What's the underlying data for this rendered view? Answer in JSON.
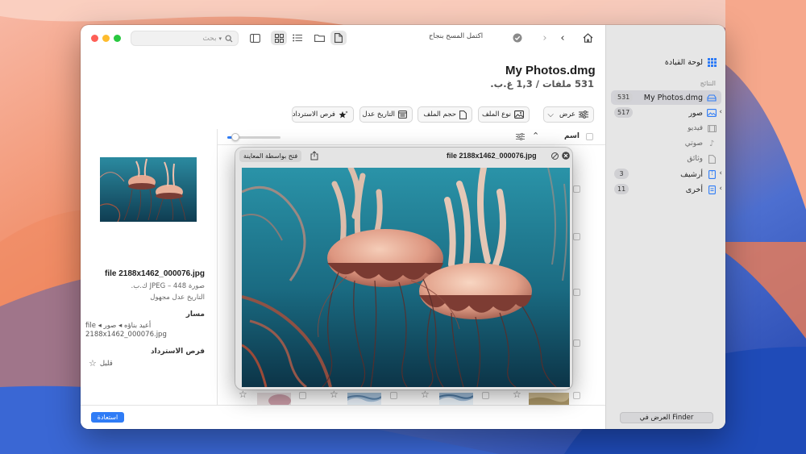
{
  "toolbar": {
    "search_placeholder": "بحث",
    "status_text": "اكتمل المسح بنجاح"
  },
  "header": {
    "title": "My Photos.dmg",
    "subtitle": "531 ملفات / 1,3 غ.ب."
  },
  "filters": {
    "view": "عرض",
    "file_type": "نوع الملف",
    "file_size": "حجم الملف",
    "date_modified": "التاريخ عدل",
    "recovery_chances": "فرص الاسترداد"
  },
  "list": {
    "column_name": "اسم",
    "zoom_level": 0.15
  },
  "sidebar": {
    "dashboard": "لوحة القيادة",
    "results_section": "النتائج",
    "items": [
      {
        "label": "My Photos.dmg",
        "count": "531"
      },
      {
        "label": "صور",
        "count": "517"
      },
      {
        "label": "فيديو",
        "count": ""
      },
      {
        "label": "صوتي",
        "count": ""
      },
      {
        "label": "وثائق",
        "count": ""
      },
      {
        "label": "أرشيف",
        "count": "3"
      },
      {
        "label": "أخرى",
        "count": "11"
      }
    ],
    "finder_button": "العرض في Finder"
  },
  "preview": {
    "file_name": "file 2188x1462_000076.jpg",
    "file_type": "صورة JPEG – 448 ك.ب.",
    "date": "التاريخ عدل مجهول",
    "path_label": "مسار",
    "path_value": "أعيد بناؤه ◂ صور ◂ file 2188x1462_000076.jpg",
    "chance_label": "فرص الاسترداد",
    "chance_value": "قليل"
  },
  "quicklook": {
    "title": "file 2188x1462_000076.jpg",
    "open_with": "فتح بواسطة المعاينة"
  },
  "footer": {
    "restore_button": "استعادة"
  },
  "colors": {
    "accent": "#2f7cf6",
    "close": "#fe5f57",
    "minimize": "#febc2e",
    "zoom": "#28c840"
  }
}
